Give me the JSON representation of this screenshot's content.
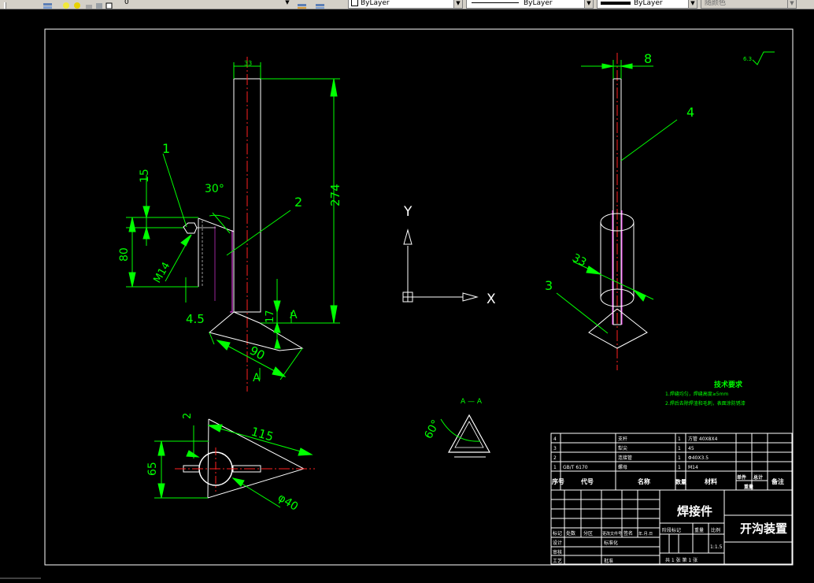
{
  "toolbar": {
    "layer_value": "0",
    "color_value": "ByLayer",
    "linetype_value": "ByLayer",
    "lineweight_value": "ByLayer",
    "plotstyle_value": "随颜色"
  },
  "drawing": {
    "dimensions": {
      "d_top_width": "33",
      "d_274": "274",
      "d_15": "15",
      "d_30deg": "30°",
      "d_80": "80",
      "d_m14": "M14",
      "d_4_5": "4.5",
      "d_17": "17",
      "d_90": "90",
      "d_8": "8",
      "d_33": "33",
      "d_2": "2",
      "d_115": "115",
      "d_65": "65",
      "d_phi40": "φ40",
      "d_60deg": "60°",
      "surface_finish": "6.3"
    },
    "section_marks": {
      "a_upper": "A",
      "a_lower": "A",
      "section_title": "A — A"
    },
    "balloons": [
      "1",
      "2",
      "3",
      "4"
    ],
    "ucs": {
      "y": "Y",
      "x": "X"
    },
    "tech_req": {
      "title": "技术要求",
      "line1": "1.焊缝均匀，焊缝高度≥5mm",
      "line2": "2.焊后去除焊渣和毛刺，表面涂防锈漆"
    }
  },
  "title_block": {
    "parts": [
      {
        "no": "4",
        "code": "",
        "name": "支杆",
        "qty": "1",
        "material": "方管 40X8X4"
      },
      {
        "no": "3",
        "code": "",
        "name": "犁尖",
        "qty": "1",
        "material": "45"
      },
      {
        "no": "2",
        "code": "",
        "name": "连接管",
        "qty": "1",
        "material": "Φ40X3.5"
      },
      {
        "no": "1",
        "code": "GB/T 6170",
        "name": "螺母",
        "qty": "1",
        "material": "M14"
      }
    ],
    "headers": {
      "no": "序号",
      "code": "代号",
      "name": "名称",
      "qty": "数量",
      "material": "材料",
      "unit": "单件",
      "total": "总计",
      "weight": "重量",
      "note": "备注"
    },
    "rev_headers": [
      "标记",
      "处数",
      "分区",
      "更改文件号",
      "签名",
      "年.月.日"
    ],
    "designer": "设计",
    "standardization": "标准化",
    "review": "审核",
    "process": "工艺",
    "approve": "批准",
    "stage": "阶段标记",
    "weight_label": "重量",
    "scale_label": "比例",
    "scale_value": "1:1.5",
    "sheet_text": "共 1 张  第 1 张",
    "material_title": "焊接件",
    "drawing_name": "开沟装置"
  }
}
